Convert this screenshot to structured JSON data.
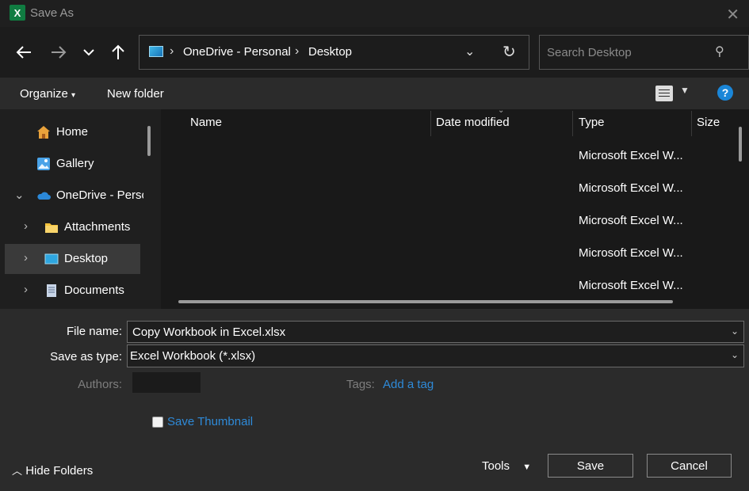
{
  "window": {
    "title": "Save As",
    "app_icon_letter": "X"
  },
  "nav": {
    "back_icon": "back-arrow-icon",
    "forward_icon": "forward-arrow-icon",
    "recent_icon": "chevron-down-icon",
    "up_icon": "up-arrow-icon",
    "breadcrumbs": [
      "OneDrive - Personal",
      "Desktop"
    ],
    "search_placeholder": "Search Desktop"
  },
  "toolbar": {
    "organize": "Organize",
    "new_folder": "New folder",
    "help": "?"
  },
  "sidebar": {
    "items": [
      {
        "label": "Home"
      },
      {
        "label": "Gallery"
      },
      {
        "label": "OneDrive - Personal"
      },
      {
        "label": "Attachments"
      },
      {
        "label": "Desktop"
      },
      {
        "label": "Documents"
      }
    ]
  },
  "files": {
    "columns": [
      "Name",
      "Date modified",
      "Type",
      "Size"
    ],
    "rows": [
      {
        "name": "",
        "date_modified": "",
        "type": "Microsoft Excel W...",
        "size": ""
      },
      {
        "name": "",
        "date_modified": "",
        "type": "Microsoft Excel W...",
        "size": ""
      },
      {
        "name": "",
        "date_modified": "",
        "type": "Microsoft Excel W...",
        "size": ""
      },
      {
        "name": "",
        "date_modified": "",
        "type": "Microsoft Excel W...",
        "size": ""
      },
      {
        "name": "",
        "date_modified": "",
        "type": "Microsoft Excel W...",
        "size": ""
      }
    ]
  },
  "form": {
    "file_name_label": "File name:",
    "file_name_value": "Copy Workbook in Excel.xlsx",
    "save_type_label": "Save as type:",
    "save_type_value": "Excel Workbook (*.xlsx)",
    "authors_label": "Authors:",
    "tags_label": "Tags:",
    "tags_link": "Add a tag",
    "save_thumbnail": "Save Thumbnail"
  },
  "footer": {
    "hide_folders": "Hide Folders",
    "tools": "Tools",
    "save": "Save",
    "cancel": "Cancel"
  },
  "colors": {
    "accent": "#2e8ad8",
    "excel_green": "#107c41",
    "folder_yellow": "#f3c13a"
  }
}
